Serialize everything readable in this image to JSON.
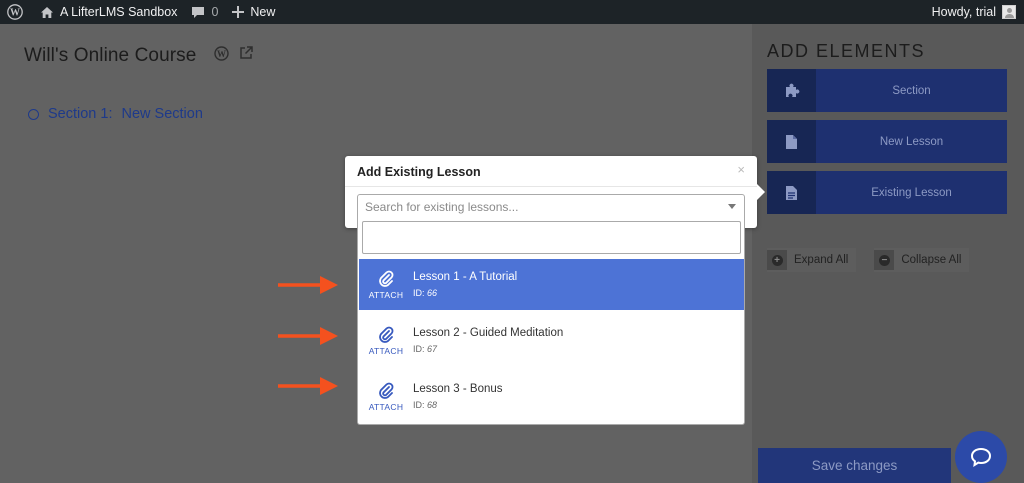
{
  "admin_bar": {
    "site_name": "A LifterLMS Sandbox",
    "comments_count": "0",
    "new_label": "New",
    "greeting": "Howdy, trial"
  },
  "course": {
    "title": "Will's Online Course",
    "section_label": "Section 1:",
    "section_name": "New Section"
  },
  "sidebar": {
    "title": "ADD ELEMENTS",
    "buttons": [
      {
        "label": "Section",
        "icon": "puzzle-icon"
      },
      {
        "label": "New Lesson",
        "icon": "document-icon"
      },
      {
        "label": "Existing Lesson",
        "icon": "document-text-icon"
      }
    ],
    "expand_all": "Expand All",
    "collapse_all": "Collapse All"
  },
  "popover": {
    "title": "Add Existing Lesson",
    "close": "×",
    "select_placeholder": "Search for existing lessons...",
    "search_value": "",
    "attach_label": "ATTACH",
    "options": [
      {
        "name": "Lesson 1 - A Tutorial",
        "id_label": "ID:",
        "id": "66",
        "highlighted": true
      },
      {
        "name": "Lesson 2 - Guided Meditation",
        "id_label": "ID:",
        "id": "67",
        "highlighted": false
      },
      {
        "name": "Lesson 3 - Bonus",
        "id_label": "ID:",
        "id": "68",
        "highlighted": false
      }
    ]
  },
  "footer": {
    "save_label": "Save changes"
  },
  "colors": {
    "accent": "#4d73d6",
    "sidebar_button": "#1e3070",
    "annotation_arrow": "#f4511e",
    "admin_bar": "#1d2327"
  }
}
